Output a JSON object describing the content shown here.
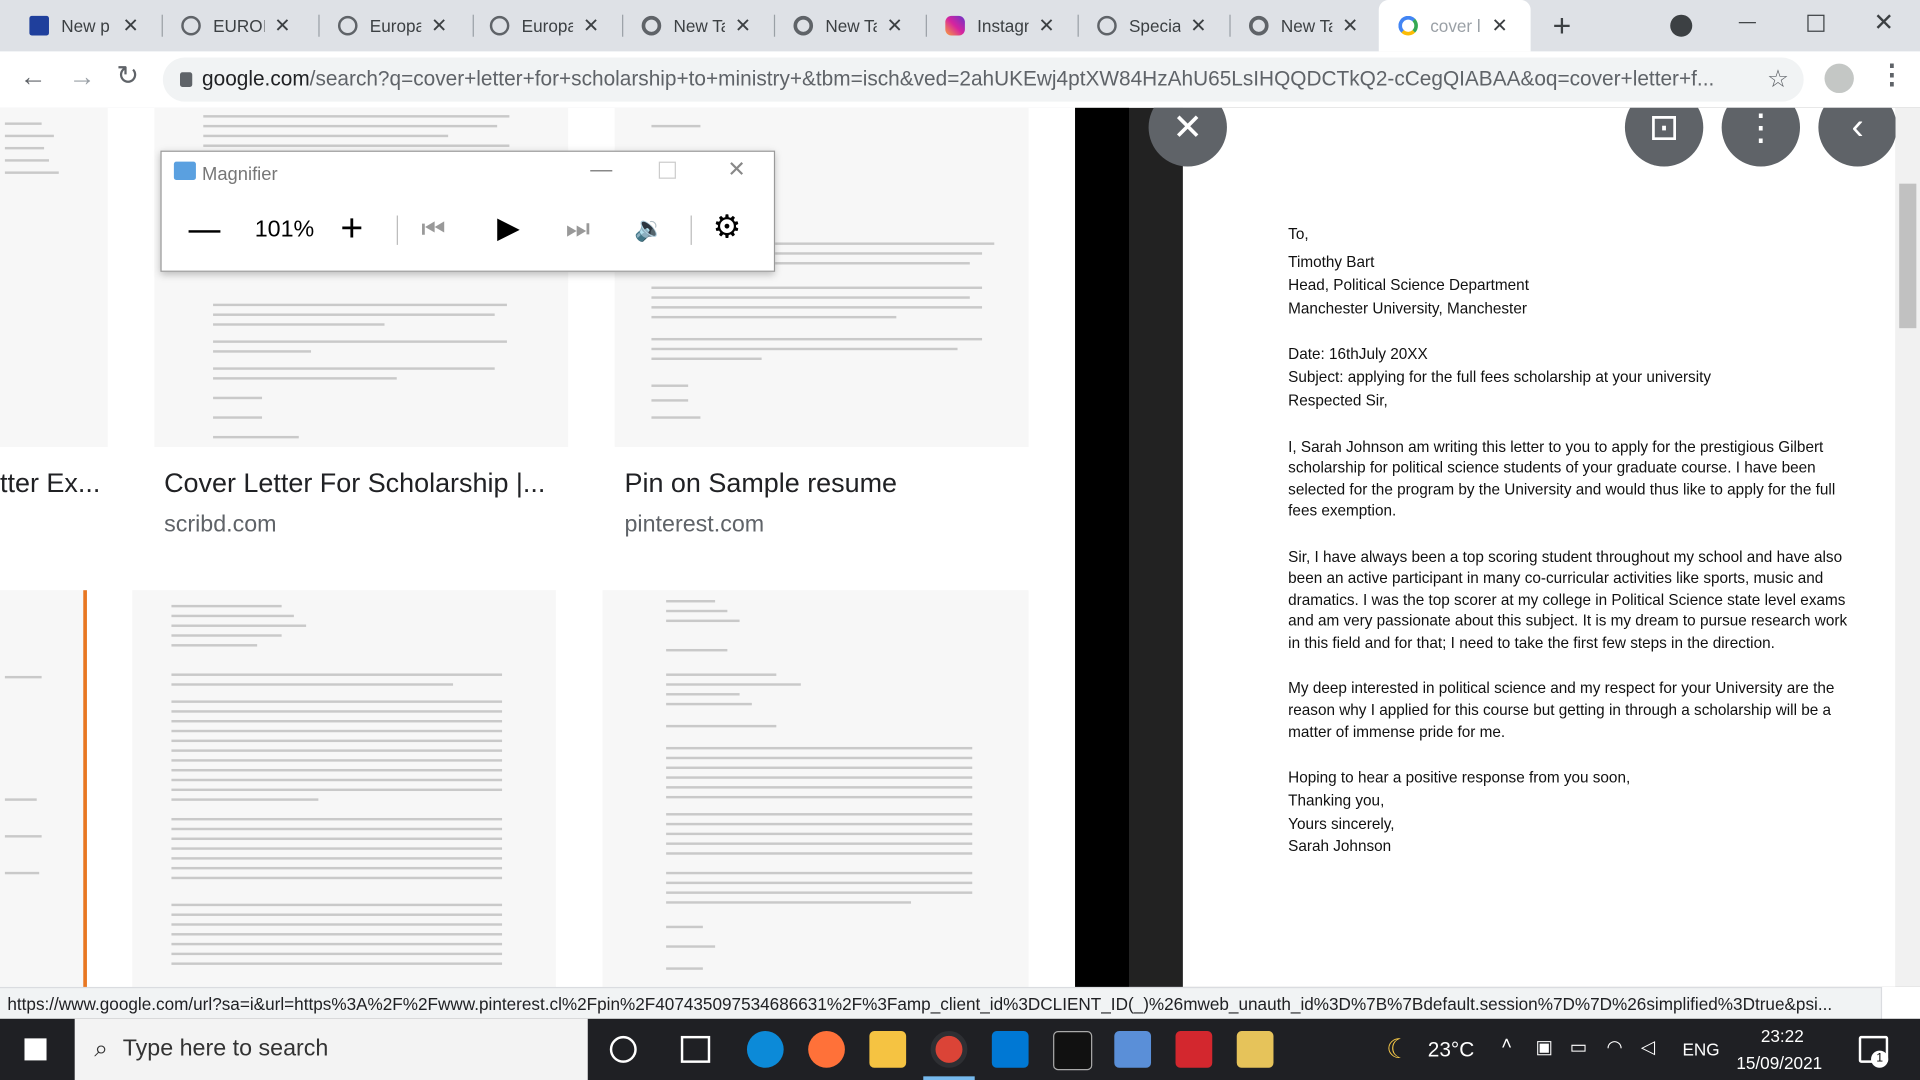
{
  "browser": {
    "tabs": [
      {
        "title": "New p",
        "icon": "eu-flag-icon",
        "color": "#1f3f9c"
      },
      {
        "title": "EUROP",
        "icon": "globe-icon",
        "color": "#5f6368"
      },
      {
        "title": "Europa",
        "icon": "globe-icon",
        "color": "#5f6368"
      },
      {
        "title": "Europa",
        "icon": "globe-icon",
        "color": "#5f6368"
      },
      {
        "title": "New Ta",
        "icon": "chrome-icon",
        "color": "#5f6368"
      },
      {
        "title": "New Ta",
        "icon": "chrome-icon",
        "color": "#5f6368"
      },
      {
        "title": "Instagr",
        "icon": "instagram-icon",
        "color": "#d6249f"
      },
      {
        "title": "Special",
        "icon": "globe-icon",
        "color": "#5f6368"
      },
      {
        "title": "New Ta",
        "icon": "chrome-icon",
        "color": "#5f6368"
      },
      {
        "title": "cover l",
        "icon": "google-icon",
        "color": "#4285f4"
      }
    ],
    "new_tab_label": "+",
    "url_domain": "google.com",
    "url_rest": "/search?q=cover+letter+for+scholarship+to+ministry+&tbm=isch&ved=2ahUKEwj4ptXW84HzAhU65LsIHQQDCTkQ2-cCegQIABAA&oq=cover+letter+f...",
    "status_url": "https://www.google.com/url?sa=i&url=https%3A%2F%2Fwww.pinterest.cl%2Fpin%2F407435097534686631%2F%3Famp_client_id%3DCLIENT_ID(_)%26mweb_unauth_id%3D%7B%7Bdefault.session%7D%7D%26simplified%3Dtrue&psi..."
  },
  "results": [
    {
      "title": "tter Ex...",
      "site": ""
    },
    {
      "title": "Cover Letter For Scholarship |...",
      "site": "scribd.com"
    },
    {
      "title": "Pin on Sample resume",
      "site": "pinterest.com"
    }
  ],
  "magnifier": {
    "title": "Magnifier",
    "zoom": "101%"
  },
  "letter": {
    "lines": [
      "To,",
      "Timothy Bart",
      "Head, Political Science Department",
      "Manchester University, Manchester",
      "Date: 16thJuly 20XX",
      "Subject: applying for the full fees scholarship at your university",
      "Respected Sir,",
      "I, Sarah Johnson am writing this letter to you to apply for the prestigious Gilbert",
      "scholarship for political science students of your graduate course. I have been",
      "selected for the program by the University and would thus like to apply for the full",
      "fees exemption.",
      "Sir, I have always been a top scoring student throughout my school and have also",
      "been an active participant in many co-curricular activities like sports, music and",
      "dramatics. I was the top scorer at my college in Political Science state level exams",
      "and am very passionate about this subject. It is my dream to pursue research work",
      "in this field and for that; I need to take the first few steps in the direction.",
      "My deep interested in political science and my respect for your University are the",
      "reason why I applied for this course but getting in through a scholarship will be a",
      "matter of immense pride for me.",
      "Hoping to hear a positive response from you soon,",
      "Thanking you,",
      "Yours sincerely,",
      "Sarah Johnson"
    ]
  },
  "taskbar": {
    "search_placeholder": "Type here to search",
    "weather": "23°C",
    "language": "ENG",
    "time": "23:22",
    "date": "15/09/2021",
    "notification_count": "1"
  }
}
